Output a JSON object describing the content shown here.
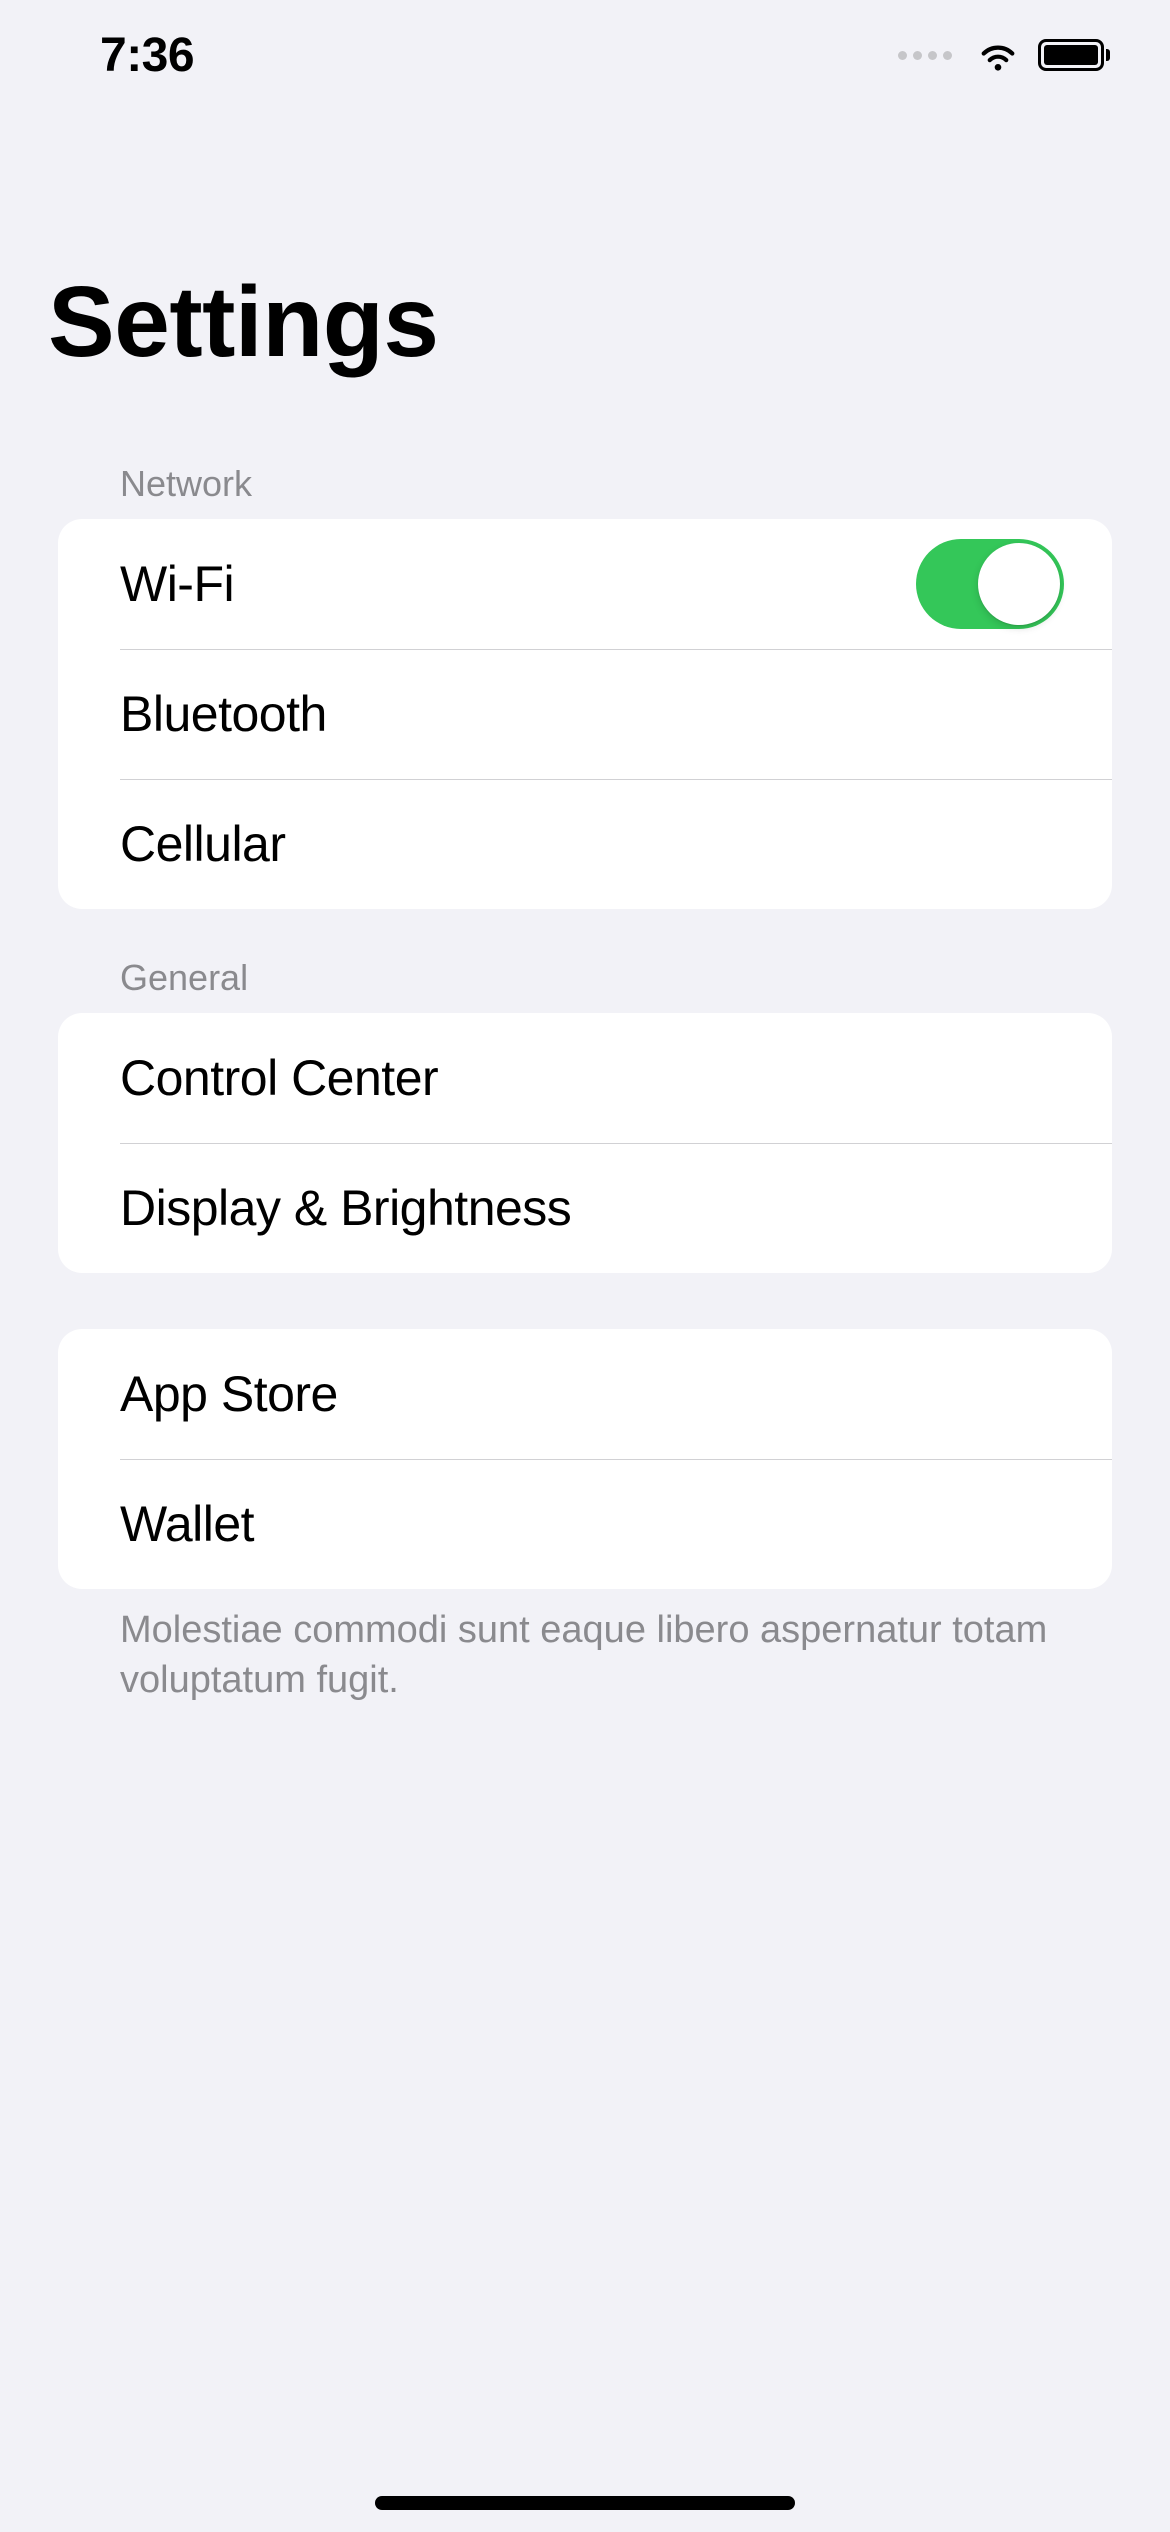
{
  "statusBar": {
    "time": "7:36"
  },
  "page": {
    "title": "Settings"
  },
  "sections": {
    "network": {
      "header": "Network",
      "items": {
        "wifi": {
          "label": "Wi-Fi",
          "toggle": true
        },
        "bluetooth": {
          "label": "Bluetooth"
        },
        "cellular": {
          "label": "Cellular"
        }
      }
    },
    "general": {
      "header": "General",
      "items": {
        "controlCenter": {
          "label": "Control Center"
        },
        "displayBrightness": {
          "label": "Display & Brightness"
        }
      }
    },
    "apps": {
      "items": {
        "appStore": {
          "label": "App Store"
        },
        "wallet": {
          "label": "Wallet"
        }
      },
      "footer": "Molestiae commodi sunt eaque libero aspernatur totam voluptatum fugit."
    }
  }
}
